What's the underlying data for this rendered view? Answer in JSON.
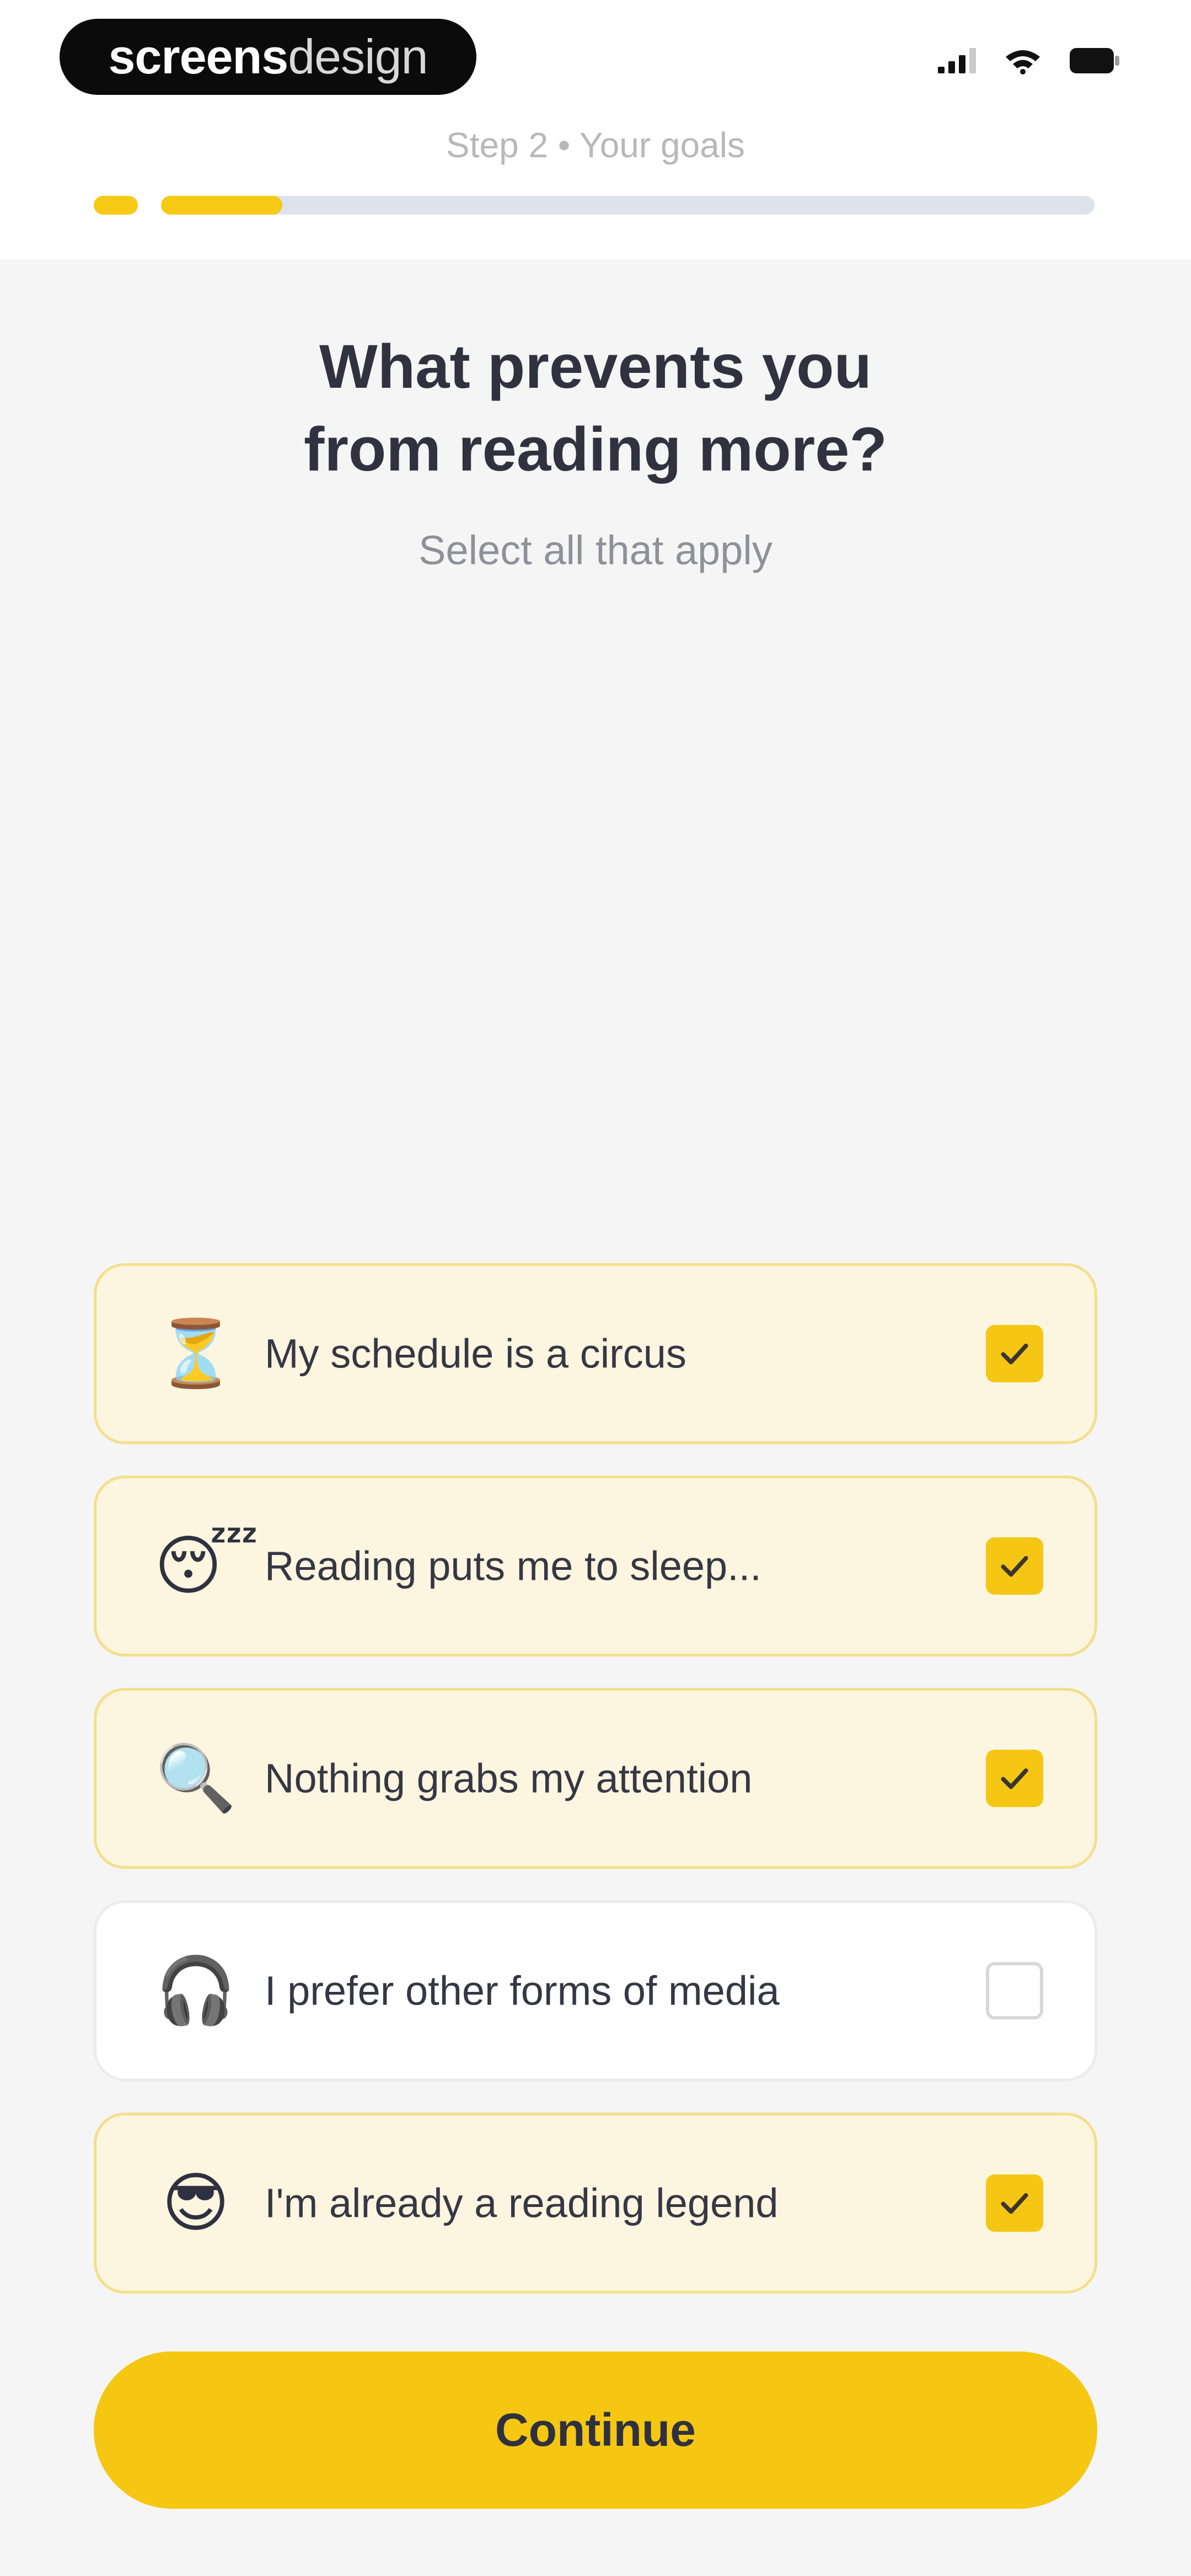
{
  "brand": {
    "bold": "screens",
    "light": "design"
  },
  "status_bar": {
    "icons": [
      "signal-icon",
      "wifi-icon",
      "battery-icon"
    ]
  },
  "step": {
    "label": "Step 2 • Your goals",
    "current": 2,
    "progress_fraction": 0.13
  },
  "title": {
    "line1": "What prevents you",
    "line2": "from reading more?"
  },
  "subtitle": "Select all that apply",
  "options": [
    {
      "emoji": "⏳",
      "icon": "hourglass-icon",
      "label": "My schedule is a circus",
      "selected": true
    },
    {
      "emoji": "😴",
      "icon": "sleeping-face-icon",
      "label": "Reading puts me to sleep...",
      "selected": true
    },
    {
      "emoji": "🔍",
      "icon": "magnifying-glass-icon",
      "label": "Nothing grabs my attention",
      "selected": true
    },
    {
      "emoji": "🎧",
      "icon": "headphones-icon",
      "label": "I prefer other forms of media",
      "selected": false
    },
    {
      "emoji": "😎",
      "icon": "sunglasses-face-icon",
      "label": "I'm already a reading legend",
      "selected": true
    }
  ],
  "continue_label": "Continue",
  "colors": {
    "accent": "#f5c712",
    "selected_background": "#fcf5df",
    "selected_border": "#f3df8d",
    "text": "#30323f",
    "muted": "#8f9099"
  }
}
